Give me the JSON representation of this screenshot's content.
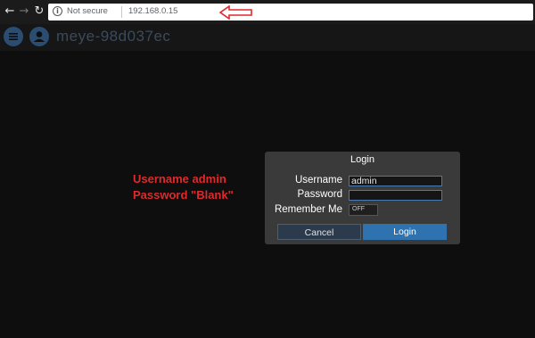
{
  "browser": {
    "security_text": "Not secure",
    "url": "192.168.0.15",
    "arrow_color": "#e0292b"
  },
  "app": {
    "title": "meye-98d037ec",
    "accent": "#2b4d72"
  },
  "annotation": {
    "line1": "Username admin",
    "line2": "Password \"Blank\"",
    "color": "#e0292b"
  },
  "login": {
    "title": "Login",
    "username_label": "Username",
    "username_value": "admin",
    "password_label": "Password",
    "password_value": "",
    "remember_label": "Remember Me",
    "remember_toggle": "OFF",
    "cancel_label": "Cancel",
    "login_label": "Login",
    "login_color": "#2e72b0"
  }
}
